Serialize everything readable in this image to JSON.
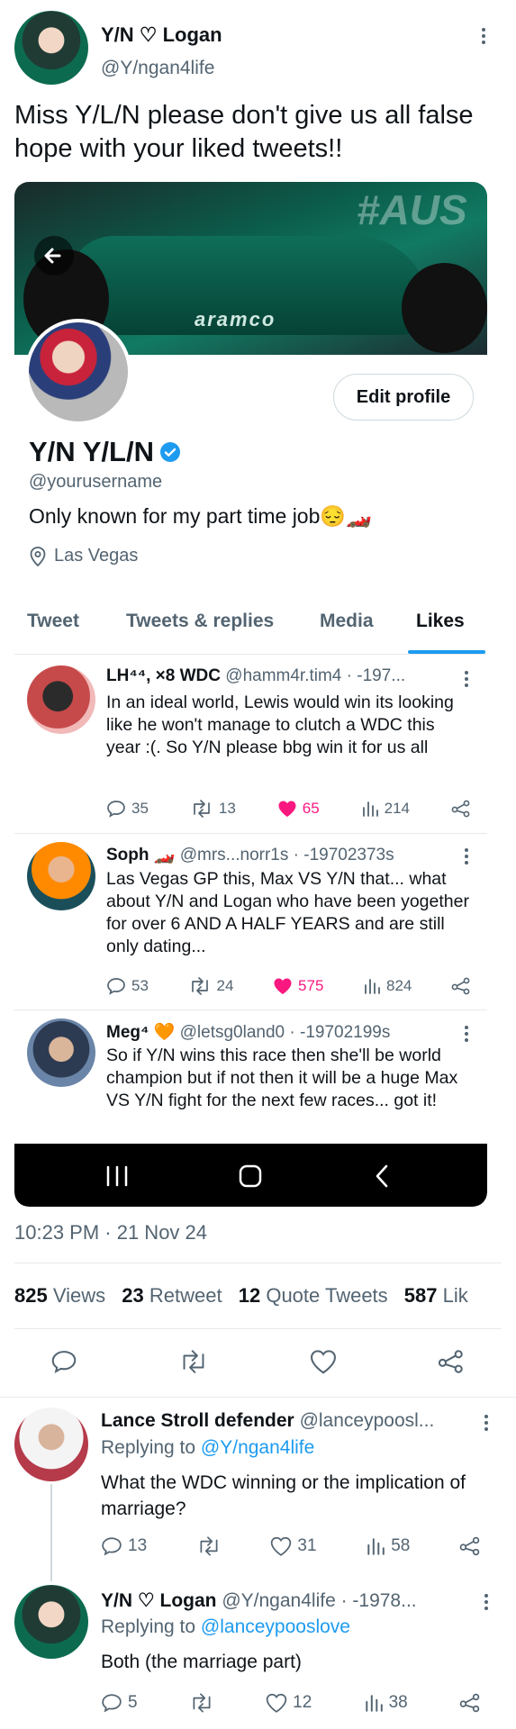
{
  "main_tweet": {
    "name": "Y/N ♡ Logan",
    "handle": "@Y/ngan4life",
    "text": "Miss Y/L/N please don't give us all false hope with your liked tweets!!"
  },
  "profile_card": {
    "banner_overlay_text": "#AUS",
    "banner_sponsor_text": "aramco",
    "edit_profile_label": "Edit profile",
    "name": "Y/N Y/L/N",
    "handle": "@yourusername",
    "bio": "Only known for my part time job😔🏎️",
    "location": "Las Vegas",
    "tabs": [
      "Tweet",
      "Tweets & replies",
      "Media",
      "Likes"
    ],
    "active_tab": "Likes",
    "liked_tweets": [
      {
        "name": "LH⁴⁴, ×8 WDC",
        "handle_time": "@hamm4r.tim4 · -197...",
        "text": "In an ideal world, Lewis would win its looking like he won't manage to clutch a WDC this year :(. So Y/N please bbg win it for us all",
        "replies": "35",
        "retweets": "13",
        "likes": "65",
        "views": "214"
      },
      {
        "name": "Soph 🏎️",
        "handle_time": "@mrs...norr1s · -19702373s",
        "text": "Las Vegas GP this, Max VS Y/N that... what about Y/N and Logan who have been yogether for over 6 AND A HALF YEARS and are still only dating...",
        "replies": "53",
        "retweets": "24",
        "likes": "575",
        "views": "824"
      },
      {
        "name": "Meg⁴ 🧡",
        "handle_time": "@letsg0land0 · -19702199s",
        "text": "So if Y/N wins this race then she'll be world champion but if not then it will be a huge Max VS Y/N fight for the next few races... got it!"
      }
    ]
  },
  "meta": {
    "timestamp": "10:23 PM · 21 Nov 24",
    "views_count": "825",
    "views_label": "Views",
    "retweet_count": "23",
    "retweet_label": "Retweet",
    "quote_count": "12",
    "quote_label": "Quote Tweets",
    "likes_count": "587",
    "likes_label": "Lik"
  },
  "replies": [
    {
      "name": "Lance Stroll defender",
      "handle_time": "@lanceypoosl...",
      "replying_prefix": "Replying to",
      "replying_to": "@Y/ngan4life",
      "text": "What the WDC winning or the implication of marriage?",
      "replies": "13",
      "likes": "31",
      "views": "58"
    },
    {
      "name": "Y/N ♡ Logan",
      "handle_time": "@Y/ngan4life · -1978...",
      "replying_prefix": "Replying to",
      "replying_to": "@lanceypooslove",
      "text": "Both (the marriage part)",
      "replies": "5",
      "likes": "12",
      "views": "38"
    }
  ],
  "colors": {
    "accent": "#1d9bf0",
    "like_red": "#f91880",
    "muted": "#536471",
    "banner_green": "#0b5e4c"
  }
}
